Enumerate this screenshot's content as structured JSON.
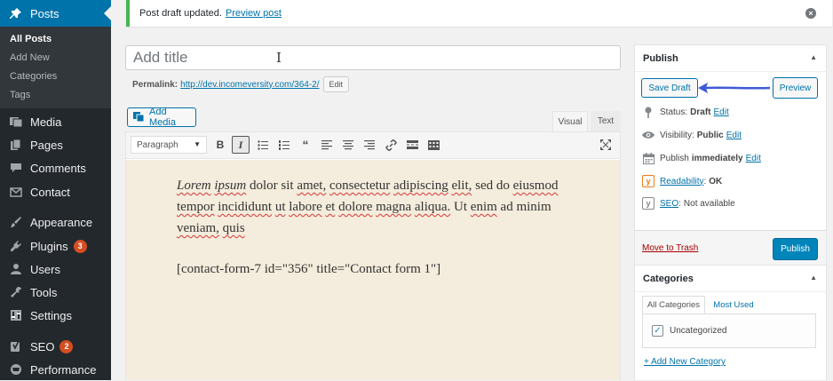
{
  "sidebar": {
    "items": [
      {
        "label": "Posts",
        "icon": "pushpin-icon"
      },
      {
        "label": "Media",
        "icon": "media-icon"
      },
      {
        "label": "Pages",
        "icon": "pages-icon"
      },
      {
        "label": "Comments",
        "icon": "comments-icon"
      },
      {
        "label": "Contact",
        "icon": "envelope-icon"
      },
      {
        "label": "Appearance",
        "icon": "paintbrush-icon"
      },
      {
        "label": "Plugins",
        "icon": "plugins-icon",
        "badge": "3"
      },
      {
        "label": "Users",
        "icon": "users-icon"
      },
      {
        "label": "Tools",
        "icon": "wrench-icon"
      },
      {
        "label": "Settings",
        "icon": "settings-icon"
      },
      {
        "label": "SEO",
        "icon": "yoast-icon",
        "badge": "2"
      },
      {
        "label": "Performance",
        "icon": "performance-icon"
      }
    ],
    "submenu": [
      "All Posts",
      "Add New",
      "Categories",
      "Tags"
    ]
  },
  "notice": {
    "text": "Post draft updated.",
    "link": "Preview post"
  },
  "title": {
    "placeholder": "Add title",
    "cursor_glyph": "I"
  },
  "permalink": {
    "label": "Permalink:",
    "url": "http://dev.incomeversity.com/364-2/",
    "edit_label": "Edit"
  },
  "editor": {
    "add_media_label": "Add Media",
    "tab_visual": "Visual",
    "tab_text": "Text",
    "format_select": "Paragraph",
    "paragraph1_words": [
      "Lorem",
      "ipsum",
      "dolor",
      "sit",
      "amet,",
      "consectetur",
      "adipiscing",
      "elit,",
      "sed",
      "do",
      "eiusmod",
      "tempor",
      "incididunt",
      "ut",
      "labore",
      "et",
      "dolore",
      "magna",
      "aliqua.",
      "Ut",
      "enim",
      "ad",
      "minim",
      "veniam,",
      "quis"
    ],
    "paragraph2": "[contact-form-7 id=\"356\" title=\"Contact form 1\"]"
  },
  "publish": {
    "title": "Publish",
    "save_draft": "Save Draft",
    "preview": "Preview",
    "status_label": "Status:",
    "status_value": "Draft",
    "visibility_label": "Visibility:",
    "visibility_value": "Public",
    "schedule_label": "Publish",
    "schedule_value": "immediately",
    "readability_label": "Readability",
    "readability_value": "OK",
    "seo_label": "SEO",
    "seo_value": "Not available",
    "edit_label": "Edit",
    "trash_label": "Move to Trash",
    "publish_button": "Publish"
  },
  "categories": {
    "title": "Categories",
    "tab_all": "All Categories",
    "tab_used": "Most Used",
    "items": [
      {
        "label": "Uncategorized",
        "checked": true
      }
    ],
    "add_new": "+ Add New Category"
  },
  "colors": {
    "sidebar_bg": "#23282d",
    "accent": "#0073aa",
    "notice_success": "#46b450",
    "badge": "#d54e21",
    "content_bg": "#f4ecdc",
    "annotation_arrow": "#3f5bd5"
  }
}
